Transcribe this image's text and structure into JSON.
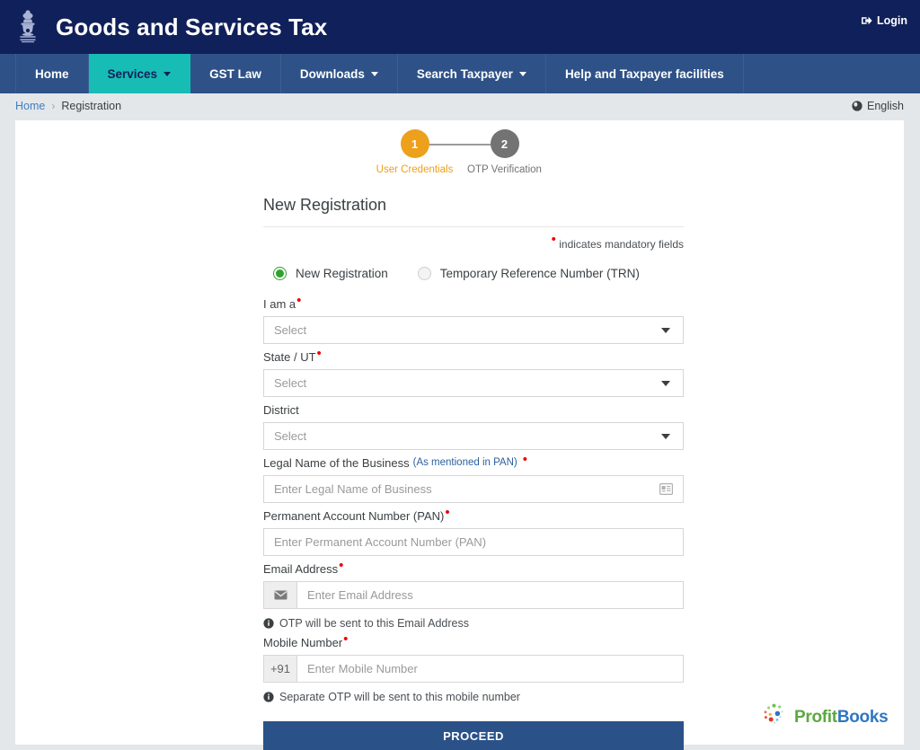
{
  "header": {
    "emblem_icon": "india-state-emblem",
    "title": "Goods and Services Tax",
    "login_label": "Login",
    "login_icon": "sign-in-icon",
    "bg_color": "#10205a"
  },
  "nav": {
    "bg_color": "#2e5288",
    "active_color": "#17bdb4",
    "items": [
      {
        "label": "Home",
        "caret": false,
        "active": false
      },
      {
        "label": "Services",
        "caret": true,
        "active": true
      },
      {
        "label": "GST Law",
        "caret": false,
        "active": false
      },
      {
        "label": "Downloads",
        "caret": true,
        "active": false
      },
      {
        "label": "Search Taxpayer",
        "caret": true,
        "active": false
      },
      {
        "label": "Help and Taxpayer facilities",
        "caret": false,
        "active": false
      }
    ]
  },
  "breadcrumb": {
    "home": "Home",
    "separator": "›",
    "current": "Registration",
    "language": "English",
    "language_icon": "globe-icon"
  },
  "stepper": {
    "steps": [
      {
        "number": "1",
        "label": "User Credentials",
        "state": "active",
        "color": "#eda01c"
      },
      {
        "number": "2",
        "label": "OTP Verification",
        "state": "idle",
        "color": "#737373"
      }
    ]
  },
  "form": {
    "title": "New Registration",
    "mandatory_note": "indicates mandatory fields",
    "registration_type": {
      "selected": "new",
      "options": [
        {
          "id": "new",
          "label": "New Registration",
          "checked": true
        },
        {
          "id": "trn",
          "label": "Temporary Reference Number (TRN)",
          "checked": false
        }
      ]
    },
    "i_am_a": {
      "label": "I am a",
      "required": true,
      "value": "Select",
      "icon": "chevron-down-icon"
    },
    "state_ut": {
      "label": "State / UT",
      "required": true,
      "value": "Select",
      "icon": "chevron-down-icon"
    },
    "district": {
      "label": "District",
      "required": false,
      "value": "Select",
      "icon": "chevron-down-icon"
    },
    "legal_name": {
      "label": "Legal Name of the Business",
      "hint": "(As mentioned in PAN)",
      "required": true,
      "placeholder": "Enter Legal Name of Business",
      "icon": "id-card-icon"
    },
    "pan": {
      "label": "Permanent Account Number (PAN)",
      "required": true,
      "placeholder": "Enter Permanent Account Number (PAN)"
    },
    "email": {
      "label": "Email Address",
      "required": true,
      "placeholder": "Enter Email Address",
      "addon_icon": "envelope-icon",
      "note": "OTP will be sent to this Email Address",
      "note_icon": "info-icon"
    },
    "mobile": {
      "label": "Mobile Number",
      "required": true,
      "placeholder": "Enter Mobile Number",
      "addon_text": "+91",
      "note": "Separate OTP will be sent to this mobile number",
      "note_icon": "info-icon"
    },
    "proceed_label": "PROCEED",
    "proceed_color": "#2b5288"
  },
  "footer_logo": {
    "icon": "profitbooks-dots-icon",
    "text_first": "Profit",
    "text_second": "Books",
    "color_first": "#5aa93f",
    "color_second": "#2f77c0"
  }
}
